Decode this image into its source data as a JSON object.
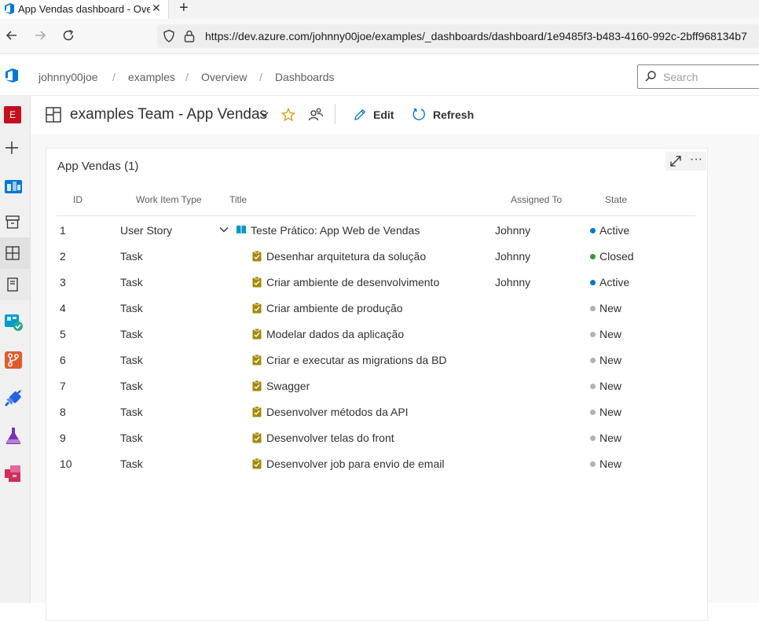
{
  "browser": {
    "tab_title": "App Vendas dashboard - Overvi",
    "tab_close": "✕",
    "new_tab": "+",
    "url": "https://dev.azure.com/johnny00joe/examples/_dashboards/dashboard/1e9485f3-b483-4160-992c-2bff968134b7"
  },
  "header": {
    "breadcrumbs": [
      "johnny00joe",
      "examples",
      "Overview",
      "Dashboards"
    ],
    "separator": "/",
    "search_placeholder": "Search"
  },
  "rail": {
    "avatar_letter": "E",
    "colors": {
      "avatar": "#c50f1f",
      "boards": "#0078d4",
      "repos": "#e05b2b",
      "pipelines": "#2560e0",
      "test": "#7b33b3",
      "artifacts": "#cc2f5a"
    }
  },
  "toolbar": {
    "title": "examples Team - App Vendas",
    "edit_label": "Edit",
    "refresh_label": "Refresh"
  },
  "widget": {
    "title": "App Vendas (1)",
    "more": "···",
    "columns": {
      "id": "ID",
      "type": "Work Item Type",
      "title": "Title",
      "assigned": "Assigned To",
      "state": "State"
    },
    "rows": [
      {
        "id": "1",
        "type": "User Story",
        "title": "Teste Prático: App Web de Vendas",
        "assigned": "Johnny",
        "state": "Active"
      },
      {
        "id": "2",
        "type": "Task",
        "title": "Desenhar arquitetura da solução",
        "assigned": "Johnny",
        "state": "Closed"
      },
      {
        "id": "3",
        "type": "Task",
        "title": "Criar ambiente de desenvolvimento",
        "assigned": "Johnny",
        "state": "Active"
      },
      {
        "id": "4",
        "type": "Task",
        "title": "Criar ambiente de produção",
        "assigned": "",
        "state": "New"
      },
      {
        "id": "5",
        "type": "Task",
        "title": "Modelar dados da aplicação",
        "assigned": "",
        "state": "New"
      },
      {
        "id": "6",
        "type": "Task",
        "title": "Criar e executar as migrations da BD",
        "assigned": "",
        "state": "New"
      },
      {
        "id": "7",
        "type": "Task",
        "title": "Swagger",
        "assigned": "",
        "state": "New"
      },
      {
        "id": "8",
        "type": "Task",
        "title": "Desenvolver métodos da API",
        "assigned": "",
        "state": "New"
      },
      {
        "id": "9",
        "type": "Task",
        "title": "Desenvolver telas do front",
        "assigned": "",
        "state": "New"
      },
      {
        "id": "10",
        "type": "Task",
        "title": "Desenvolver job para envio de email",
        "assigned": "",
        "state": "New"
      }
    ],
    "state_colors": {
      "Active": "#0078d4",
      "Closed": "#339933",
      "New": "#b2b2b2"
    },
    "type_colors": {
      "User Story": "#0098c7",
      "Task": "#a4880a"
    }
  }
}
